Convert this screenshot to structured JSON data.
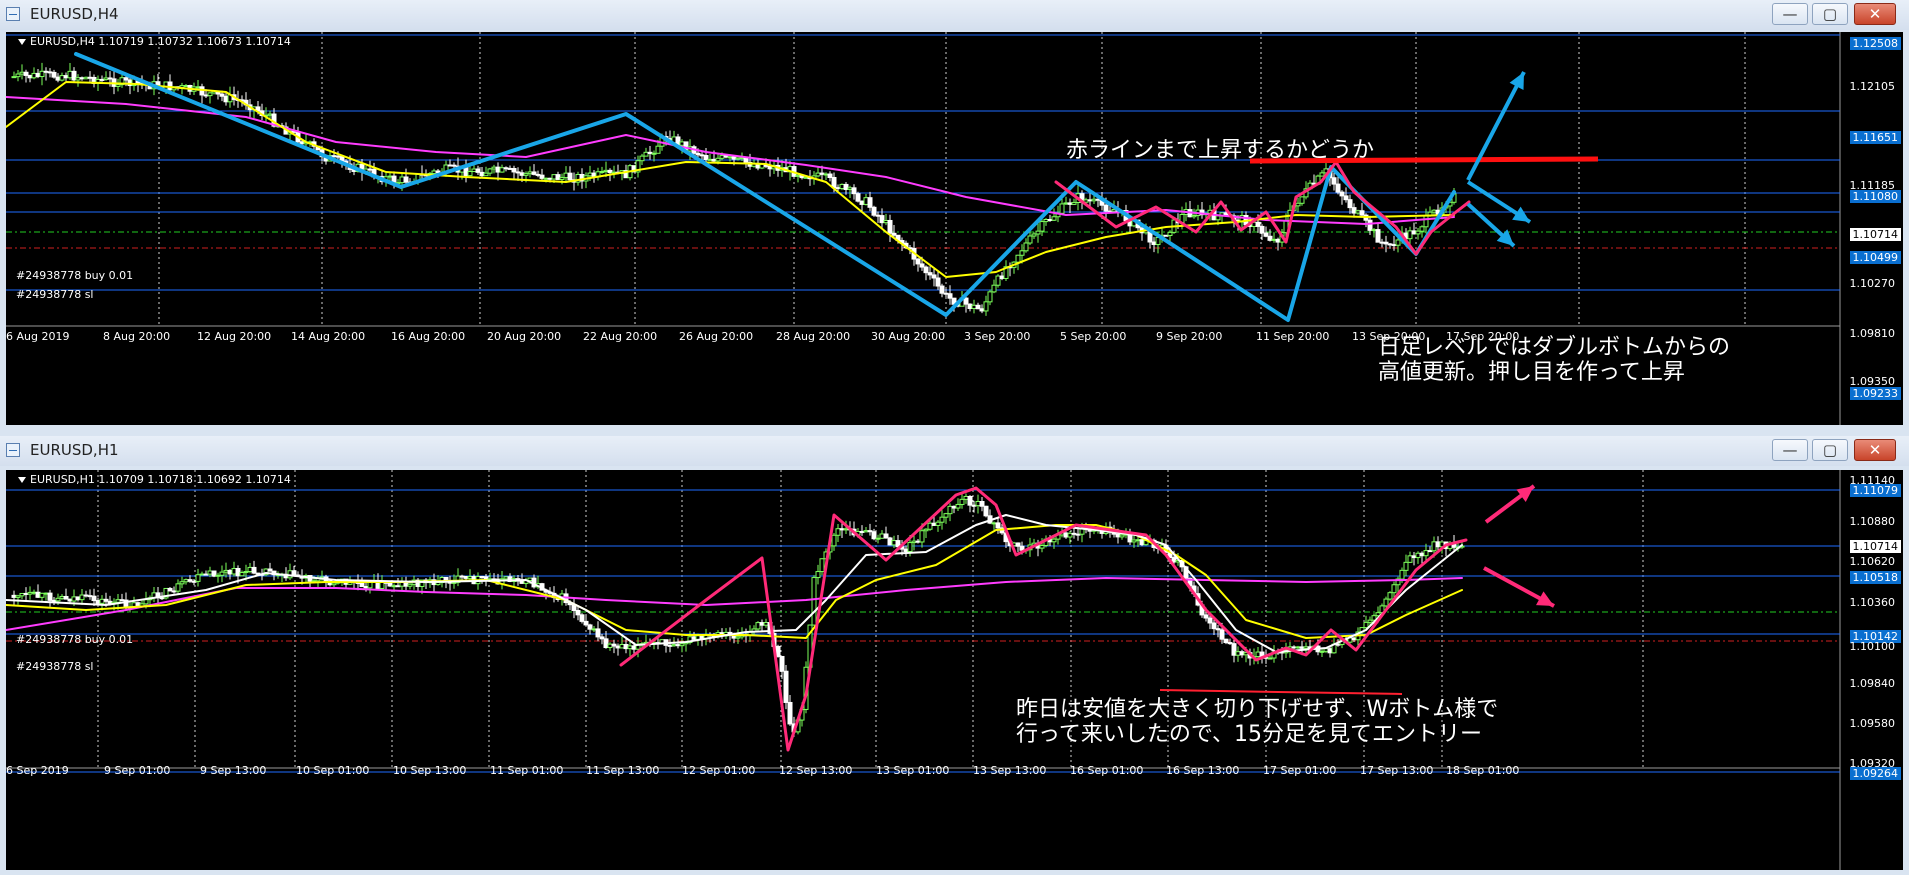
{
  "colors": {
    "window_bg": "#d9e4f1",
    "chart_bg": "#000000",
    "bull": "#7cff5a",
    "bear": "#ffffff",
    "ma_fast": "#ffffff",
    "ma_mid": "#ffff00",
    "ma_slow": "#ff3cff",
    "hline": "#1e6cff",
    "trade_line": "#ff2020",
    "sl_line": "#22cc22",
    "annot_blue": "#19a6e8",
    "annot_pink": "#ff2a78",
    "annot_red": "#ff1010"
  },
  "window1": {
    "title": "EURUSD,H4",
    "header": "EURUSD,H4  1.10719 1.10732 1.10673 1.10714",
    "trade_buy": "#24938778 buy 0.01",
    "trade_sl": "#24938778 sl",
    "price_labels": [
      "1.12105",
      "1.11185",
      "1.10270",
      "1.09810",
      "1.09350"
    ],
    "price_tags": [
      {
        "text": "1.12508",
        "style": "blue"
      },
      {
        "text": "1.11651",
        "style": "blue"
      },
      {
        "text": "1.11080",
        "style": "blue"
      },
      {
        "text": "1.10714",
        "style": "white"
      },
      {
        "text": "1.10499",
        "style": "blue"
      },
      {
        "text": "1.09233",
        "style": "blue"
      }
    ],
    "x_labels": [
      "6 Aug 2019",
      "8 Aug 20:00",
      "12 Aug 20:00",
      "14 Aug 20:00",
      "16 Aug 20:00",
      "20 Aug 20:00",
      "22 Aug 20:00",
      "26 Aug 20:00",
      "28 Aug 20:00",
      "30 Aug 20:00",
      "3 Sep 20:00",
      "5 Sep 20:00",
      "9 Sep 20:00",
      "11 Sep 20:00",
      "13 Sep 20:00",
      "17 Sep 20:00"
    ],
    "note_top": "赤ラインまで上昇するかどうか",
    "note_bottom_1": "日足レベルではダブルボトムからの",
    "note_bottom_2": "高値更新。押し目を作って上昇"
  },
  "window2": {
    "title": "EURUSD,H1",
    "header": "EURUSD,H1  1.10709 1.10718 1.10692 1.10714",
    "trade_buy": "#24938778 buy 0.01",
    "trade_sl": "#24938778 sl",
    "price_labels": [
      "1.11140",
      "1.10880",
      "1.10620",
      "1.10360",
      "1.10100",
      "1.09840",
      "1.09580",
      "1.09320"
    ],
    "price_tags": [
      {
        "text": "1.11079",
        "style": "blue"
      },
      {
        "text": "1.10714",
        "style": "white"
      },
      {
        "text": "1.10518",
        "style": "blue"
      },
      {
        "text": "1.10142",
        "style": "blue"
      },
      {
        "text": "1.09264",
        "style": "blue"
      }
    ],
    "x_labels": [
      "6 Sep 2019",
      "9 Sep 01:00",
      "9 Sep 13:00",
      "10 Sep 01:00",
      "10 Sep 13:00",
      "11 Sep 01:00",
      "11 Sep 13:00",
      "12 Sep 01:00",
      "12 Sep 13:00",
      "13 Sep 01:00",
      "13 Sep 13:00",
      "16 Sep 01:00",
      "16 Sep 13:00",
      "17 Sep 01:00",
      "17 Sep 13:00",
      "18 Sep 01:00"
    ],
    "note_1": "昨日は安値を大きく切り下げせず、Wボトム様で",
    "note_2": "行って来いしたので、15分足を見てエントリー"
  },
  "buttons": {
    "minimize": "—",
    "maximize": "▢",
    "close": "✕"
  }
}
